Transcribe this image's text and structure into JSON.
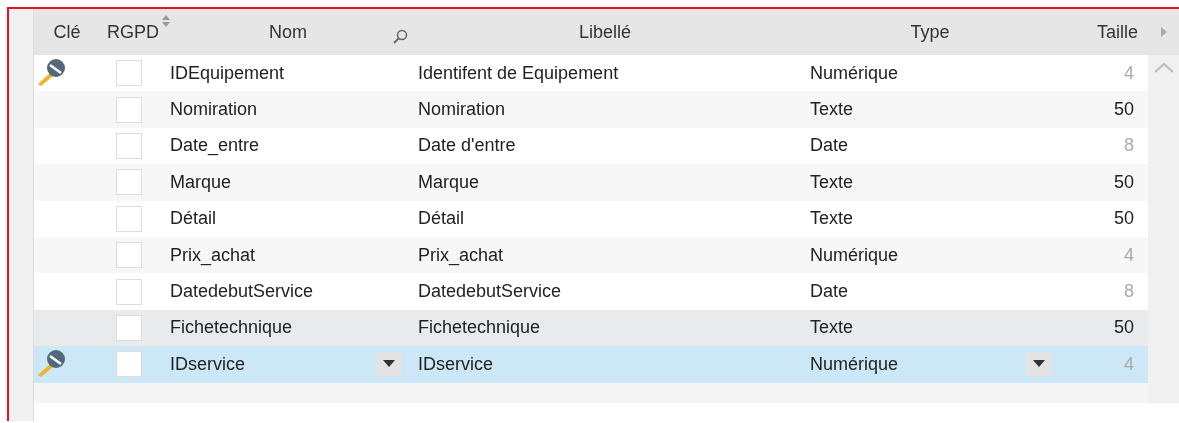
{
  "columns": [
    "Clé",
    "RGPD",
    "Nom",
    "Libellé",
    "Type",
    "Taille"
  ],
  "rows": [
    {
      "key": true,
      "rgpd_checked": false,
      "name": "IDEquipement",
      "label": "Identifent de Equipement",
      "type": "Numérique",
      "size": "4",
      "size_disabled": true,
      "highlighted": false,
      "selected": false
    },
    {
      "key": false,
      "rgpd_checked": false,
      "name": "Nomiration",
      "label": "Nomiration",
      "type": "Texte",
      "size": "50",
      "size_disabled": false,
      "highlighted": false,
      "selected": false
    },
    {
      "key": false,
      "rgpd_checked": false,
      "name": "Date_entre",
      "label": "Date d'entre",
      "type": "Date",
      "size": "8",
      "size_disabled": true,
      "highlighted": false,
      "selected": false
    },
    {
      "key": false,
      "rgpd_checked": false,
      "name": "Marque",
      "label": "Marque",
      "type": "Texte",
      "size": "50",
      "size_disabled": false,
      "highlighted": false,
      "selected": false
    },
    {
      "key": false,
      "rgpd_checked": false,
      "name": "Détail",
      "label": "Détail",
      "type": "Texte",
      "size": "50",
      "size_disabled": false,
      "highlighted": false,
      "selected": false
    },
    {
      "key": false,
      "rgpd_checked": false,
      "name": "Prix_achat",
      "label": "Prix_achat",
      "type": "Numérique",
      "size": "4",
      "size_disabled": true,
      "highlighted": false,
      "selected": false
    },
    {
      "key": false,
      "rgpd_checked": false,
      "name": "DatedebutService",
      "label": "DatedebutService",
      "type": "Date",
      "size": "8",
      "size_disabled": true,
      "highlighted": false,
      "selected": false
    },
    {
      "key": false,
      "rgpd_checked": false,
      "name": "Fichetechnique",
      "label": "Fichetechnique",
      "type": "Texte",
      "size": "50",
      "size_disabled": false,
      "highlighted": true,
      "selected": false
    },
    {
      "key": true,
      "rgpd_checked": false,
      "name": "IDservice",
      "label": "IDservice",
      "type": "Numérique",
      "size": "4",
      "size_disabled": true,
      "highlighted": false,
      "selected": true
    }
  ]
}
